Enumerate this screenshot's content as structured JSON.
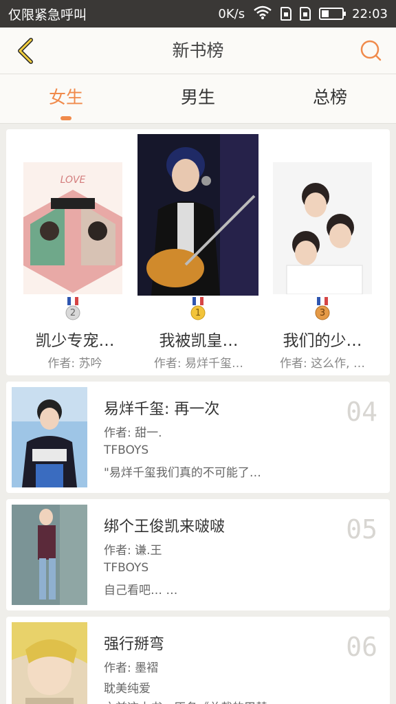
{
  "status_bar": {
    "left_text": "仅限紧急呼叫",
    "net_speed": "0K/s",
    "time": "22:03",
    "battery_level": 0.35,
    "icons": [
      "wifi-icon",
      "sim1-icon",
      "sim2-icon",
      "battery-icon"
    ]
  },
  "header": {
    "title": "新书榜",
    "back_icon": "chevron-left-icon",
    "search_icon": "search-icon",
    "accent_color": "#f08a4b"
  },
  "tabs": [
    {
      "label": "女生",
      "active": true
    },
    {
      "label": "男生",
      "active": false
    },
    {
      "label": "总榜",
      "active": false
    }
  ],
  "top3": [
    {
      "rank": "2",
      "title": "凯少专宠…",
      "author": "作者:  苏吟"
    },
    {
      "rank": "1",
      "title": "我被凯皇…",
      "author": "作者:  易烊千玺…"
    },
    {
      "rank": "3",
      "title": "我们的少…",
      "author": "作者:  这么作, …"
    }
  ],
  "list": [
    {
      "rank": "04",
      "title": "易烊千玺: 再一次",
      "author": "作者: 甜一.",
      "tag": "TFBOYS",
      "desc": "\"易烊千玺我们真的不可能了…"
    },
    {
      "rank": "05",
      "title": "绑个王俊凯来啵啵",
      "author": "作者: 谦.王",
      "tag": "TFBOYS",
      "desc": "自己看吧… …"
    },
    {
      "rank": "06",
      "title": "强行掰弯",
      "author": "作者: 墨褶",
      "tag": "耽美纯爱",
      "desc": "之前这本书，原名《总裁的甲替"
    }
  ]
}
